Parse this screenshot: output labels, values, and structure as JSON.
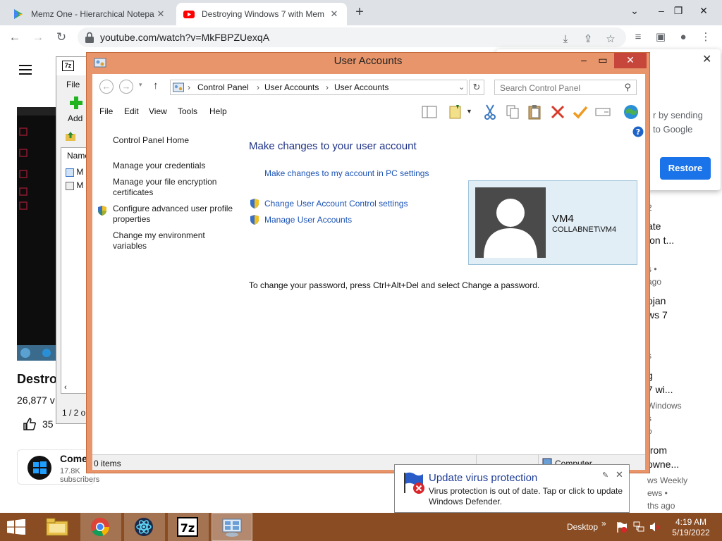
{
  "browser": {
    "tabs": [
      {
        "title": "Memz One - Hierarchical Notepa",
        "active": false
      },
      {
        "title": "Destroying Windows 7 with Mem",
        "active": true
      }
    ],
    "new_tab": "+",
    "url": "youtube.com/watch?v=MkFBPZUexqA"
  },
  "youtube": {
    "video_title": "Destro",
    "views": "26,877 v",
    "likes": "35",
    "channel_name": "Come",
    "subscribers": "17.8K subscribers",
    "side_items": [
      {
        "text": "2",
        "meta": true
      },
      {
        "text": "ate",
        "meta": false
      },
      {
        "text": "ion t...",
        "meta": false
      },
      {
        "text": "s •",
        "meta": true
      },
      {
        "text": "ago",
        "meta": true
      },
      {
        "text": "ojan",
        "meta": false
      },
      {
        "text": "ws 7",
        "meta": false
      },
      {
        "text": "•",
        "meta": true
      },
      {
        "text": "s",
        "meta": true
      },
      {
        "text": "g",
        "meta": false
      },
      {
        "text": "7 wi...",
        "meta": false
      },
      {
        "text": "Windows",
        "meta": true
      },
      {
        "text": "s",
        "meta": true
      },
      {
        "text": "o",
        "meta": true
      },
      {
        "text": "from",
        "meta": false
      },
      {
        "text": "owne...",
        "meta": false
      },
      {
        "text": "ws Weekly",
        "meta": true
      },
      {
        "text": "ews •",
        "meta": true
      },
      {
        "text": "ths ago",
        "meta": true
      }
    ],
    "restore_popup": {
      "line1": "r by sending",
      "line2": "to Google",
      "button": "Restore"
    }
  },
  "sevenzip": {
    "logo": "7z",
    "menu": "File",
    "add": "Add",
    "column": "Name",
    "rows": [
      "M",
      "M"
    ],
    "status": "1 / 2 o"
  },
  "window": {
    "title": "User Accounts",
    "breadcrumb": [
      "Control Panel",
      "User Accounts",
      "User Accounts"
    ],
    "search_placeholder": "Search Control Panel",
    "menu": [
      "File",
      "Edit",
      "View",
      "Tools",
      "Help"
    ],
    "left_links": [
      "Control Panel Home",
      "Manage your credentials",
      "Manage your file encryption certificates",
      "Configure advanced user profile properties",
      "Change my environment variables"
    ],
    "heading": "Make changes to your user account",
    "links": {
      "pc_settings": "Make changes to my account in PC settings",
      "uac": "Change User Account Control settings",
      "manage": "Manage User Accounts"
    },
    "password_note": "To change your password, press Ctrl+Alt+Del and select Change a password.",
    "user": {
      "name": "VM4",
      "domain": "COLLABNET\\VM4"
    },
    "status_left": "0 items",
    "status_right": "Computer"
  },
  "toast": {
    "title": "Update virus protection",
    "body": "Virus protection is out of date. Tap or click to update Windows Defender."
  },
  "taskbar": {
    "desktop_label": "Desktop",
    "time": "4:19 AM",
    "date": "5/19/2022",
    "chevron": "»"
  },
  "colors": {
    "taskbar": "#8a4c22",
    "window_frame": "#e8956b",
    "close_button": "#c7463b",
    "link": "#1a52b5",
    "heading": "#1e3287"
  }
}
